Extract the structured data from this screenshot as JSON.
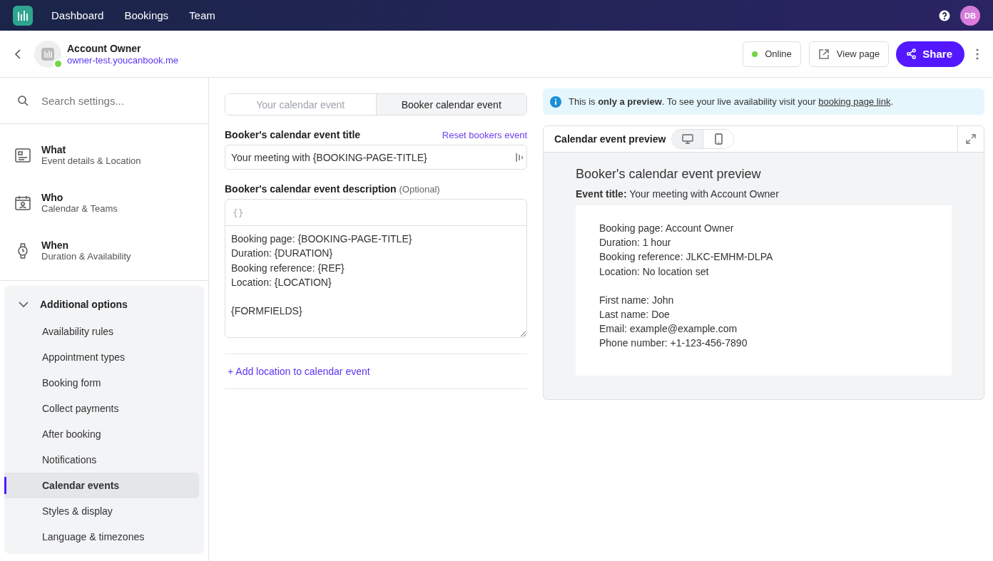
{
  "nav": {
    "items": [
      "Dashboard",
      "Bookings",
      "Team"
    ],
    "avatar": "DB"
  },
  "header": {
    "name": "Account Owner",
    "url": "owner-test.youcanbook.me",
    "online": true,
    "status": "Online",
    "view_page": "View page",
    "share": "Share"
  },
  "sidebar": {
    "search": {
      "placeholder": "Search settings..."
    },
    "sections": [
      {
        "kind": "what",
        "title": "What",
        "subtitle": "Event details & Location"
      },
      {
        "kind": "who",
        "title": "Who",
        "subtitle": "Calendar & Teams"
      },
      {
        "kind": "when",
        "title": "When",
        "subtitle": "Duration & Availability"
      }
    ],
    "group": {
      "title": "Additional options",
      "expanded": true,
      "items": [
        {
          "label": "Availability rules",
          "selected": false
        },
        {
          "label": "Appointment types",
          "selected": false
        },
        {
          "label": "Booking form",
          "selected": false
        },
        {
          "label": "Collect payments",
          "selected": false
        },
        {
          "label": "After booking",
          "selected": false
        },
        {
          "label": "Notifications",
          "selected": false
        },
        {
          "label": "Calendar events",
          "selected": true
        },
        {
          "label": "Styles & display",
          "selected": false
        },
        {
          "label": "Language & timezones",
          "selected": false
        }
      ]
    }
  },
  "tabs": [
    {
      "label": "Your calendar event",
      "selected": false
    },
    {
      "label": "Booker calendar event",
      "selected": true
    }
  ],
  "title_field": {
    "label": "Booker's calendar event title",
    "reset": "Reset bookers event",
    "value": "Your meeting with {BOOKING-PAGE-TITLE}"
  },
  "description_field": {
    "label": "Booker's calendar event description",
    "optional": "(Optional)",
    "toolbar": "{}",
    "value": "Booking page: {BOOKING-PAGE-TITLE}\nDuration: {DURATION}\nBooking reference: {REF}\nLocation: {LOCATION}\n\n{FORMFIELDS}"
  },
  "add_location": "+ Add location to calendar event",
  "banner": {
    "before": "This is **only a preview**. To see your live availability visit your ",
    "link": "booking page link",
    "after": "."
  },
  "preview": {
    "title": "Calendar event preview",
    "views": [
      {
        "kind": "desktop",
        "selected": true
      },
      {
        "kind": "mobile",
        "selected": false
      }
    ],
    "heading": "Booker's calendar event preview",
    "event_title": "**Event title:** Your meeting with Account Owner",
    "blocks": [
      [
        "Booking page: Account Owner",
        "Duration: 1 hour",
        "Booking reference: JLKC-EMHM-DLPA",
        "Location: No location set"
      ],
      [
        "First name: John",
        "Last name: Doe",
        "Email: example@example.com",
        "Phone number: +1-123-456-7890"
      ]
    ]
  }
}
